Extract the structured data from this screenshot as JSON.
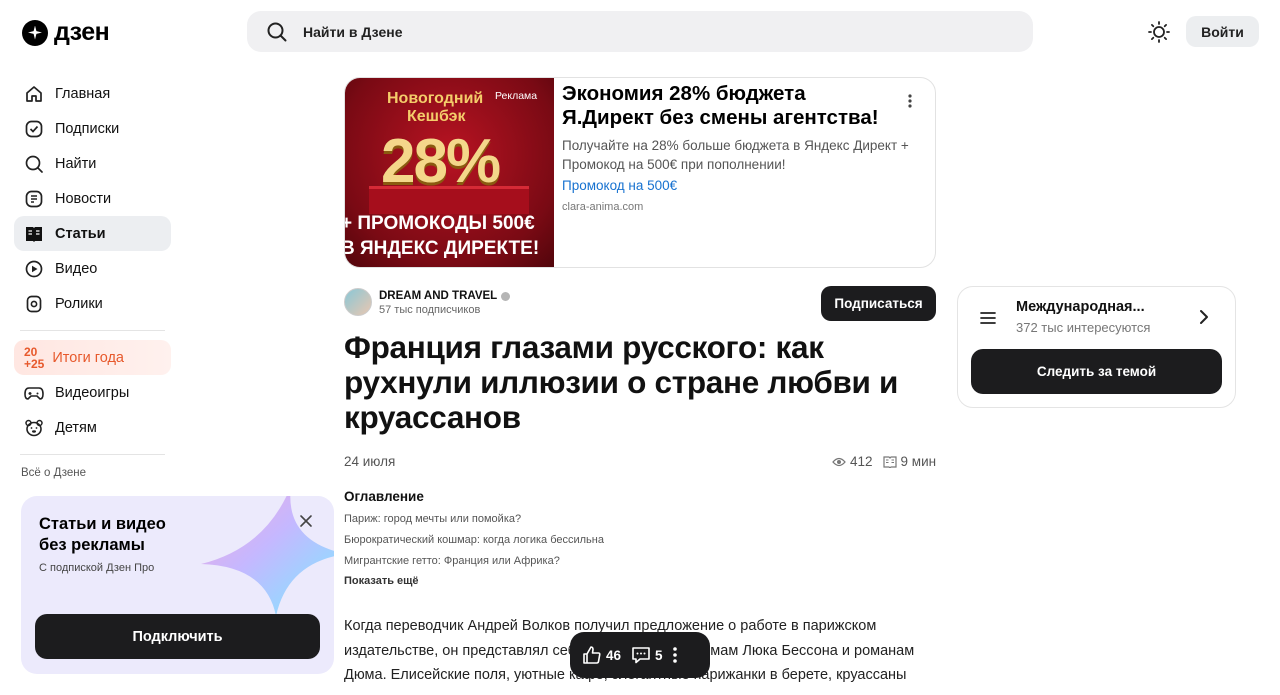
{
  "header": {
    "logo_text": "дзен",
    "search_placeholder": "Найти в Дзене",
    "login_label": "Войти"
  },
  "sidebar": {
    "items": [
      {
        "label": "Главная",
        "icon": "home-icon"
      },
      {
        "label": "Подписки",
        "icon": "subscriptions-icon"
      },
      {
        "label": "Найти",
        "icon": "search-icon"
      },
      {
        "label": "Новости",
        "icon": "news-icon"
      },
      {
        "label": "Статьи",
        "icon": "articles-icon"
      },
      {
        "label": "Видео",
        "icon": "video-icon"
      },
      {
        "label": "Ролики",
        "icon": "shorts-icon"
      }
    ],
    "year_badge_top": "20",
    "year_badge_bottom": "+25",
    "year_label": "Итоги года",
    "extra_items": [
      {
        "label": "Видеоигры",
        "icon": "gamepad-icon"
      },
      {
        "label": "Детям",
        "icon": "kids-icon"
      }
    ],
    "about_label": "Всё о Дзене"
  },
  "promo": {
    "title": "Статьи и видео без рекламы",
    "subtitle": "С подпиской Дзен Про",
    "button_label": "Подключить"
  },
  "ad": {
    "image_line1": "Новогодний",
    "image_line2": "Кешбэк",
    "image_big": "28%",
    "image_line3": "+ ПРОМОКОДЫ 500€",
    "image_line4": "В ЯНДЕКС ДИРЕКТЕ!",
    "tag": "Реклама",
    "title": "Экономия 28% бюджета Я.Директ без смены агентства!",
    "text": "Получайте на 28% больше бюджета в Яндекс Директ + Промокод на 500€ при пополнении!",
    "link": "Промокод на 500€",
    "domain": "clara-anima.com"
  },
  "channel": {
    "name": "DREAM AND TRAVEL",
    "subscribers": "57 тыс подписчиков",
    "subscribe_label": "Подписаться"
  },
  "article": {
    "title": "Франция глазами русского: как рухнули иллюзии о стране любви и круассанов",
    "date": "24 июля",
    "views": "412",
    "read_time": "9 мин",
    "toc_title": "Оглавление",
    "toc": [
      "Париж: город мечты или помойка?",
      "Бюрократический кошмар: когда логика бессильна",
      "Мигрантские гетто: Франция или Африка?"
    ],
    "toc_more": "Показать ещё",
    "body": "Когда переводчик Андрей Волков получил предложение о работе в парижском издательстве, он представлял себе Францию по фильмам Люка Бессона и романам Дюма. Елисейские поля, уютные кафе, элегантные парижанки в берете, круассаны"
  },
  "float_bar": {
    "likes": "46",
    "comments": "5"
  },
  "topic": {
    "name": "Международная...",
    "count": "372 тыс интересуются",
    "button_label": "Следить за темой"
  }
}
